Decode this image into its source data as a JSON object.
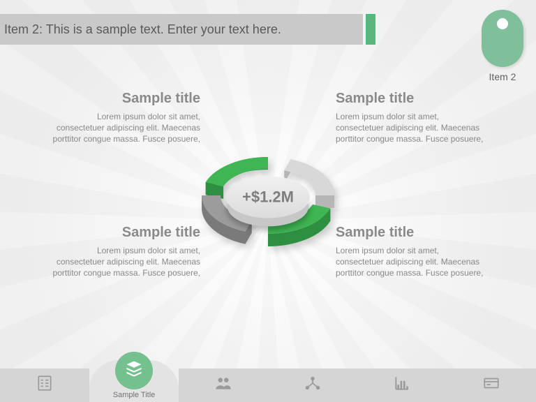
{
  "header": {
    "text": "Item 2: This is a sample text. Enter your text here."
  },
  "topRight": {
    "label": "Item 2"
  },
  "center": {
    "value": "+$1.2M"
  },
  "blocks": {
    "tl": {
      "title": "Sample title",
      "body": "Lorem ipsum dolor sit amet, consectetuer adipiscing elit. Maecenas porttitor congue massa. Fusce posuere,"
    },
    "tr": {
      "title": "Sample title",
      "body": "Lorem ipsum dolor sit amet, consectetuer adipiscing elit. Maecenas porttitor congue massa. Fusce posuere,"
    },
    "bl": {
      "title": "Sample title",
      "body": "Lorem ipsum dolor sit amet, consectetuer adipiscing elit. Maecenas porttitor congue massa. Fusce posuere,"
    },
    "br": {
      "title": "Sample title",
      "body": "Lorem ipsum dolor sit amet, consectetuer adipiscing elit. Maecenas porttitor congue massa. Fusce posuere,"
    }
  },
  "ring": {
    "segments": [
      {
        "color": "#3fb553",
        "shade": "#2e8f40"
      },
      {
        "color": "#d8d8d8",
        "shade": "#b6b6b6"
      },
      {
        "color": "#3fb553",
        "shade": "#2e8f40"
      },
      {
        "color": "#9c9c9c",
        "shade": "#7a7a7a"
      }
    ]
  },
  "nav": {
    "items": [
      {
        "icon": "checklist-icon",
        "label": ""
      },
      {
        "icon": "stack-icon",
        "label": "Sample Title"
      },
      {
        "icon": "people-icon",
        "label": ""
      },
      {
        "icon": "network-icon",
        "label": ""
      },
      {
        "icon": "barchart-icon",
        "label": ""
      },
      {
        "icon": "card-icon",
        "label": ""
      }
    ],
    "activeIndex": 1
  }
}
